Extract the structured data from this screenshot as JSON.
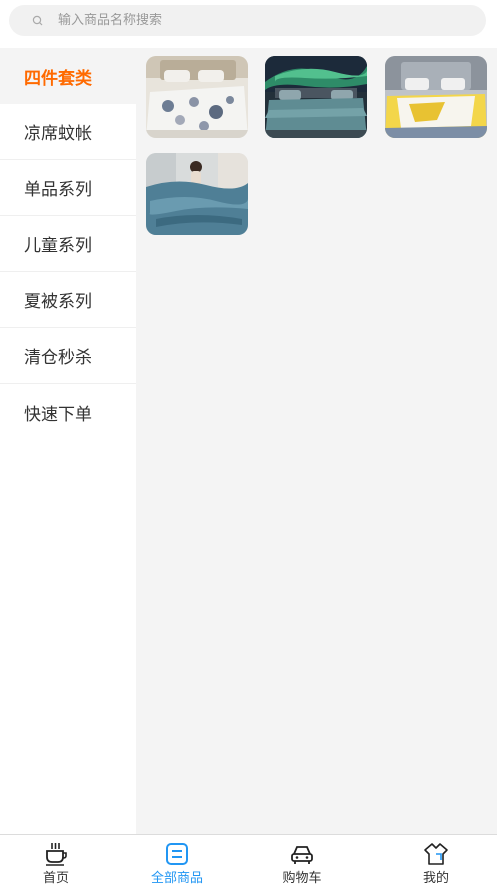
{
  "search": {
    "placeholder": "输入商品名称搜索"
  },
  "sidebar": {
    "items": [
      {
        "label": "四件套类"
      },
      {
        "label": "凉席蚊帐"
      },
      {
        "label": "单品系列"
      },
      {
        "label": "儿童系列"
      },
      {
        "label": "夏被系列"
      },
      {
        "label": "清仓秒杀"
      },
      {
        "label": "快速下单"
      }
    ],
    "active_index": 0
  },
  "products": [
    {
      "image": "bedding-floral-grey-photo"
    },
    {
      "image": "bedding-teal-aurora-photo"
    },
    {
      "image": "bedding-yellow-white-photo"
    },
    {
      "image": "bedding-blue-woman-photo"
    }
  ],
  "tabbar": {
    "items": [
      {
        "label": "首页",
        "icon": "coffee-cup-icon"
      },
      {
        "label": "全部商品",
        "icon": "catalog-icon"
      },
      {
        "label": "购物车",
        "icon": "cart-car-icon"
      },
      {
        "label": "我的",
        "icon": "shirt-icon"
      }
    ],
    "active_index": 1
  },
  "colors": {
    "accent": "#ff6a00",
    "tab_active": "#2196f3",
    "content_bg": "#f4f4f4"
  }
}
